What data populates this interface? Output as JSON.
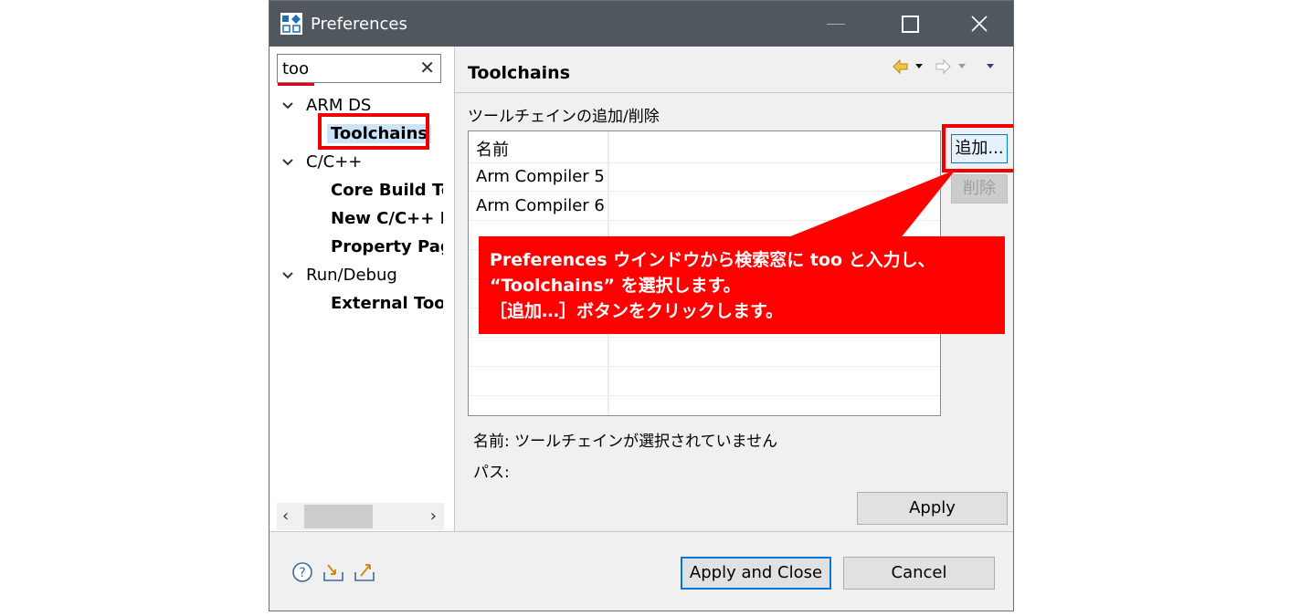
{
  "window": {
    "title": "Preferences"
  },
  "search": {
    "value": "too",
    "clear_icon": "✕"
  },
  "tree": {
    "groups": [
      {
        "label": "ARM DS",
        "items": [
          "Toolchains"
        ]
      },
      {
        "label": "C/C++",
        "items": [
          "Core Build Too",
          "New C/C++ P",
          "Property Page"
        ]
      },
      {
        "label": "Run/Debug",
        "items": [
          "External Tools"
        ]
      }
    ],
    "selected": "Toolchains"
  },
  "page": {
    "title": "Toolchains",
    "group_label": "ツールチェインの追加/削除",
    "table": {
      "header": "名前",
      "rows": [
        "Arm Compiler 5",
        "Arm Compiler 6"
      ]
    },
    "add_button": "追加...",
    "remove_button": "削除",
    "name_info": "名前:  ツールチェインが選択されていません",
    "path_info": "パス:",
    "apply_button": "Apply"
  },
  "footer": {
    "apply_close_button": "Apply and Close",
    "cancel_button": "Cancel"
  },
  "callout": {
    "line1": "Preferences ウインドウから検索窓に too と入力し、",
    "line2": "“Toolchains” を選択します。",
    "line3": "［追加…］ボタンをクリックします。"
  },
  "colors": {
    "titlebar": "#51575f",
    "highlight": "#ee0000",
    "selection": "#cce4f7",
    "accent": "#0078d7"
  }
}
